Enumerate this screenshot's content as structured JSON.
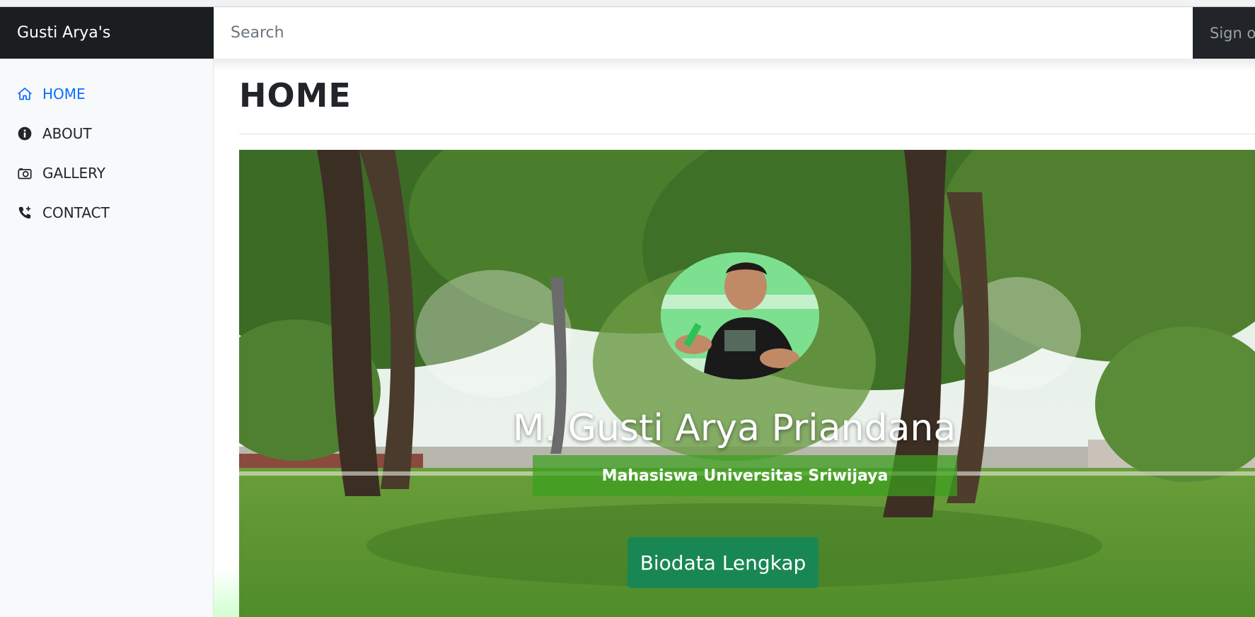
{
  "navbar": {
    "brand": "Gusti Arya's",
    "search_placeholder": "Search",
    "signout_label": "Sign ou"
  },
  "sidebar": {
    "items": [
      {
        "label": "HOME",
        "icon": "house-icon",
        "active": true
      },
      {
        "label": "ABOUT",
        "icon": "info-circle-icon",
        "active": false
      },
      {
        "label": "GALLERY",
        "icon": "camera-icon",
        "active": false
      },
      {
        "label": "CONTACT",
        "icon": "phone-plus-icon",
        "active": false
      }
    ]
  },
  "main": {
    "title": "HOME",
    "hero": {
      "name": "M. Gusti Arya Priandana",
      "subtitle": "Mahasiswa Universitas Sriwijaya",
      "button_label": "Biodata Lengkap"
    }
  },
  "colors": {
    "navbar_bg": "#212529",
    "active_link": "#0d6efd",
    "button_bg": "#198754",
    "subtitle_bg": "#3ca01e"
  }
}
